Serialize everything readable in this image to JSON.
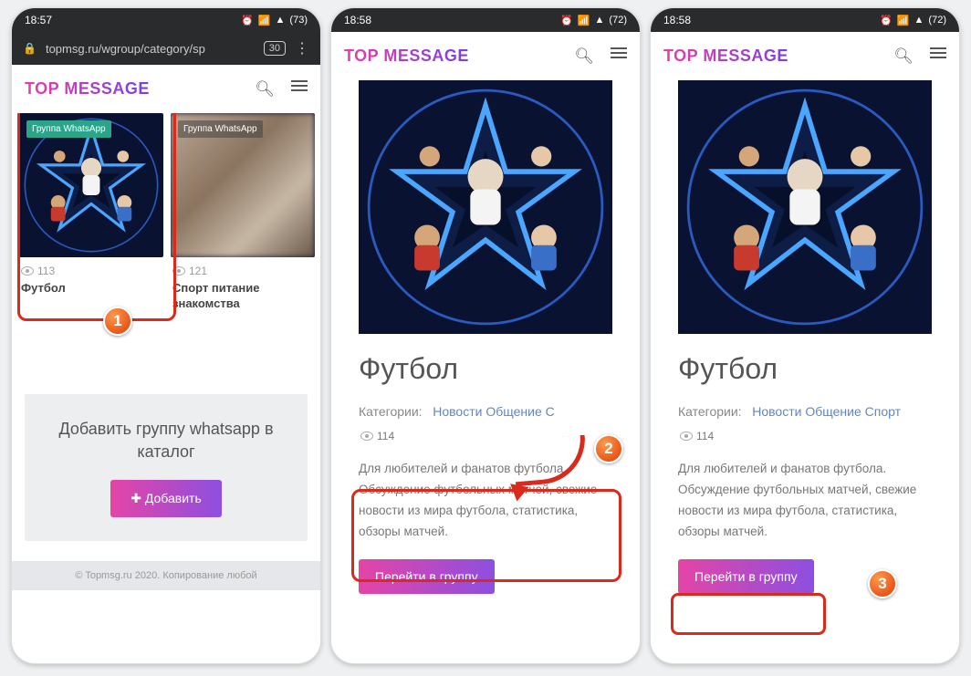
{
  "status": {
    "time1": "18:57",
    "time2": "18:58",
    "time3": "18:58",
    "battery1": "73",
    "battery2": "72",
    "battery3": "72"
  },
  "browser": {
    "url": "topmsg.ru/wgroup/category/sp",
    "tabs": "30"
  },
  "logo": "TOP MESSAGE",
  "screen1": {
    "card1": {
      "badge": "Группа WhatsApp",
      "views": "113",
      "title": "Футбол"
    },
    "card2": {
      "badge": "Группа WhatsApp",
      "views": "121",
      "title": "Спорт питание знакомства"
    },
    "addbox": {
      "title": "Добавить группу whatsapp в каталог",
      "button": "Добавить"
    },
    "footer": "© Topmsg.ru 2020. Копирование любой"
  },
  "detail": {
    "title": "Футбол",
    "catlabel": "Категории:",
    "cat1": "Новости",
    "cat2": "Общение",
    "cat3short": "С",
    "cat3": "Спорт",
    "views": "114",
    "desc": "Для любителей и фанатов футбола. Обсуждение футбольных матчей, свежие новости из мира футбола, статистика, обзоры матчей.",
    "button": "Перейти в группу"
  },
  "markers": {
    "n1": "1",
    "n2": "2",
    "n3": "3"
  }
}
